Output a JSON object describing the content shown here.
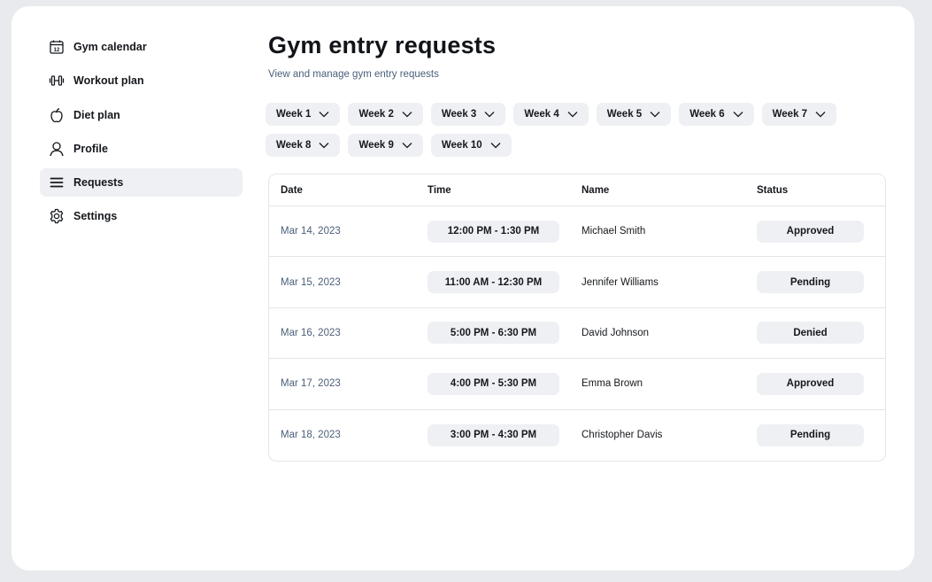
{
  "sidebar": {
    "items": [
      {
        "label": "Gym calendar",
        "icon": "calendar-icon"
      },
      {
        "label": "Workout plan",
        "icon": "dumbbell-icon"
      },
      {
        "label": "Diet plan",
        "icon": "apple-icon"
      },
      {
        "label": "Profile",
        "icon": "user-icon"
      },
      {
        "label": "Requests",
        "icon": "menu-icon",
        "active": true
      },
      {
        "label": "Settings",
        "icon": "gear-icon"
      }
    ],
    "calendar_day": "12"
  },
  "main": {
    "title": "Gym entry requests",
    "subtitle": "View and manage gym entry requests",
    "weeks": [
      "Week 1",
      "Week 2",
      "Week 3",
      "Week 4",
      "Week 5",
      "Week 6",
      "Week 7",
      "Week 8",
      "Week 9",
      "Week 10"
    ]
  },
  "table": {
    "columns": [
      "Date",
      "Time",
      "Name",
      "Status"
    ],
    "rows": [
      {
        "date": "Mar 14, 2023",
        "time": "12:00 PM - 1:30 PM",
        "name": "Michael Smith",
        "status": "Approved"
      },
      {
        "date": "Mar 15, 2023",
        "time": "11:00 AM - 12:30 PM",
        "name": "Jennifer Williams",
        "status": "Pending"
      },
      {
        "date": "Mar 16, 2023",
        "time": "5:00 PM - 6:30 PM",
        "name": "David Johnson",
        "status": "Denied"
      },
      {
        "date": "Mar 17, 2023",
        "time": "4:00 PM - 5:30 PM",
        "name": "Emma Brown",
        "status": "Approved"
      },
      {
        "date": "Mar 18, 2023",
        "time": "3:00 PM - 4:30 PM",
        "name": "Christopher Davis",
        "status": "Pending"
      }
    ]
  },
  "colors": {
    "background": "#e8eaed",
    "surface": "#ffffff",
    "pill": "#eef0f3",
    "muted_text": "#4a6079",
    "text": "#15181c"
  }
}
